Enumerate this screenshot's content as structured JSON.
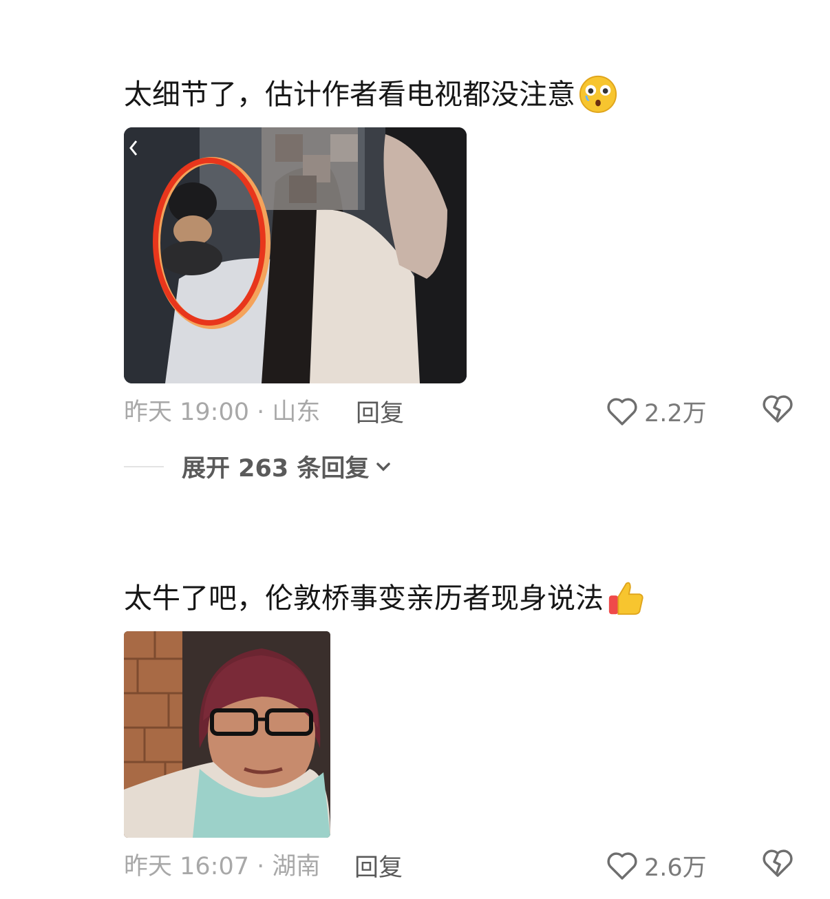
{
  "comments": [
    {
      "text": "太细节了，估计作者看电视都没注意",
      "emoji": "astonished-face-emoji",
      "image": "video-screenshot-with-red-circle",
      "time_location": "昨天 19:00 · 山东",
      "reply_label": "回复",
      "likes": "2.2万"
    },
    {
      "text": "太牛了吧，伦敦桥事变亲历者现身说法",
      "emoji": "thumbs-up-emoji",
      "image": "woman-with-glasses-photo",
      "time_location": "昨天 16:07 · 湖南",
      "reply_label": "回复",
      "likes": "2.6万"
    }
  ],
  "expand_replies": "展开 263 条回复",
  "colors": {
    "text": "#161616",
    "meta": "#a8a8a8",
    "action": "#5a5a5a",
    "circle": "#e8361c"
  },
  "icons": [
    "heart-icon",
    "broken-heart-icon",
    "chevron-down-icon",
    "back-arrow-icon"
  ]
}
